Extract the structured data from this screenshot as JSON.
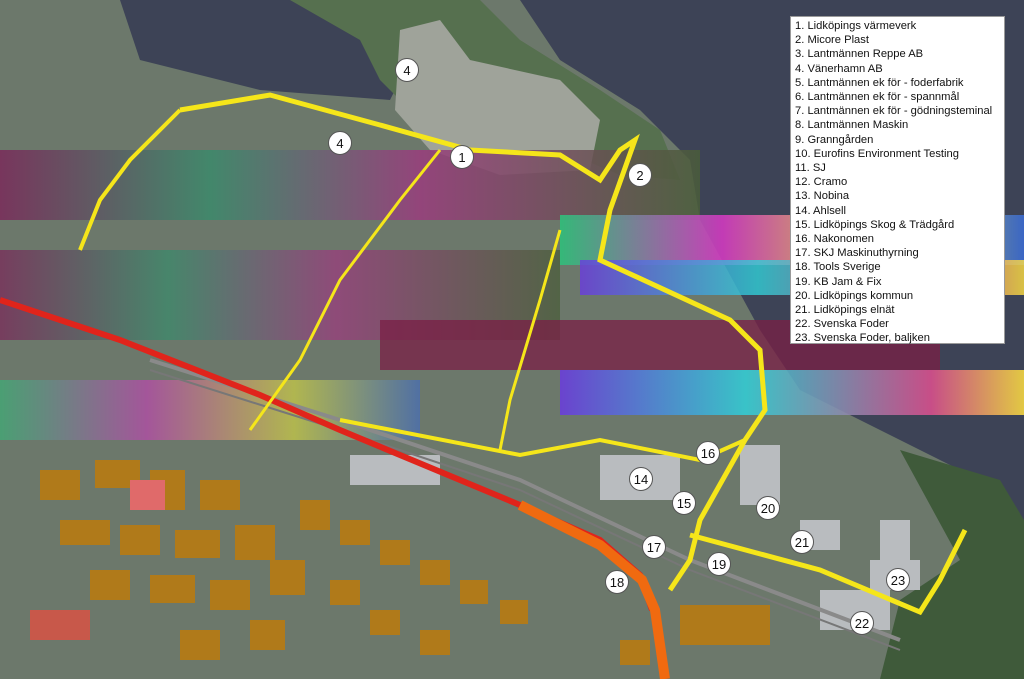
{
  "legend": {
    "items": [
      "1. Lidköpings värmeverk",
      "2. Micore Plast",
      "3. Lantmännen Reppe AB",
      "4. Vänerhamn AB",
      "5. Lantmännen ek för - foderfabrik",
      "6. Lantmännen ek för - spannmål",
      "7. Lantmännen ek för - gödningsteminal",
      "8. Lantmännen Maskin",
      "9. Granngården",
      "10. Eurofins Environment Testing",
      "11. SJ",
      "12. Cramo",
      "13. Nobina",
      "14. Ahlsell",
      "15. Lidköpings Skog & Trädgård",
      "16. Nakonomen",
      "17. SKJ Maskinuthyrning",
      "18. Tools Sverige",
      "19. KB Jam & Fix",
      "20. Lidköpings kommun",
      "21. Lidköpings elnät",
      "22. Svenska Foder",
      "23. Svenska Foder, baljken"
    ]
  },
  "markers": {
    "m4a": "4",
    "m4b": "4",
    "m1": "1",
    "m2": "2",
    "m16": "16",
    "m14": "14",
    "m15": "15",
    "m20": "20",
    "m17": "17",
    "m21": "21",
    "m19": "19",
    "m18": "18",
    "m23": "23",
    "m22": "22"
  },
  "colors": {
    "water": "#3d4356",
    "land": "#6b7b6e",
    "boundary_yellow": "#f5e61a",
    "main_road_red": "#e0241b",
    "road_orange": "#f06a10",
    "building_brown": "#b07a1a",
    "industrial_grey": "#b9bcbf"
  }
}
